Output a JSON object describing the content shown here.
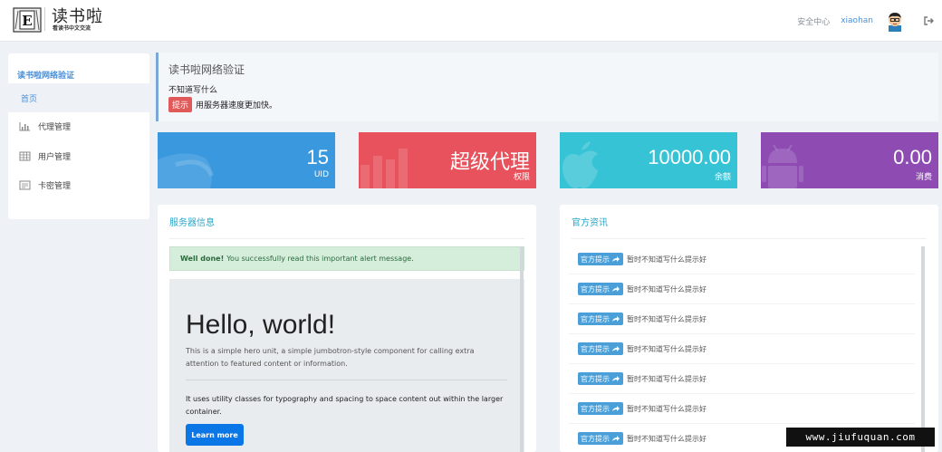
{
  "header": {
    "logo_letter": "E",
    "title": "读书啦",
    "subtitle": "看读书中文交流",
    "security_link": "安全中心",
    "username": "xiaohan"
  },
  "sidebar": {
    "title": "读书啦网络验证",
    "items": [
      {
        "label": "首页",
        "icon": "home"
      },
      {
        "label": "代理管理",
        "icon": "bar-chart-icon"
      },
      {
        "label": "用户管理",
        "icon": "table-icon"
      },
      {
        "label": "卡密管理",
        "icon": "card-icon"
      }
    ]
  },
  "notice": {
    "title": "读书啦网络验证",
    "text": "不知道写什么",
    "tip_badge": "提示",
    "tip_text": "用服务器速度更加快。"
  },
  "stats": [
    {
      "value": "15",
      "label": "UID",
      "color": "#3a98de"
    },
    {
      "value": "超级代理",
      "label": "权限",
      "color": "#e8525c"
    },
    {
      "value": "10000.00",
      "label": "余额",
      "color": "#36c3d6"
    },
    {
      "value": "0.00",
      "label": "消费",
      "color": "#8e4cb3"
    }
  ],
  "server_panel": {
    "title": "服务器信息",
    "alert_bold": "Well done!",
    "alert_text": "You successfully read this important alert message.",
    "jumbo_title": "Hello, world!",
    "jumbo_lead": "This is a simple hero unit, a simple jumbotron-style component for calling extra attention to featured content or information.",
    "jumbo_body": "It uses utility classes for typography and spacing to space content out within the larger container.",
    "jumbo_button": "Learn more"
  },
  "news_panel": {
    "title": "官方资讯",
    "items": [
      {
        "badge": "官方提示",
        "text": "暂时不知道写什么提示好"
      },
      {
        "badge": "官方提示",
        "text": "暂时不知道写什么提示好"
      },
      {
        "badge": "官方提示",
        "text": "暂时不知道写什么提示好"
      },
      {
        "badge": "官方提示",
        "text": "暂时不知道写什么提示好"
      },
      {
        "badge": "官方提示",
        "text": "暂时不知道写什么提示好"
      },
      {
        "badge": "官方提示",
        "text": "暂时不知道写什么提示好"
      },
      {
        "badge": "官方提示",
        "text": "暂时不知道写什么提示好"
      }
    ]
  },
  "watermark": "www.jiufuquan.com"
}
